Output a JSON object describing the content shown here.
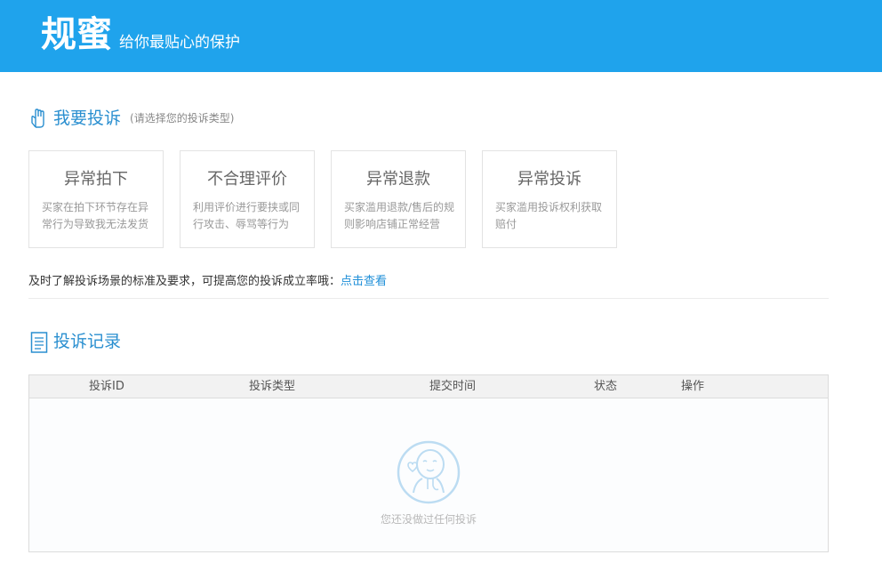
{
  "header": {
    "brand": "规蜜",
    "slogan": "给你最贴心的保护"
  },
  "complaint_section": {
    "icon": "hand-icon",
    "title": "我要投诉",
    "subtitle": "(请选择您的投诉类型)",
    "cards": [
      {
        "title": "异常拍下",
        "desc": "买家在拍下环节存在异常行为导致我无法发货"
      },
      {
        "title": "不合理评价",
        "desc": "利用评价进行要挟或同行攻击、辱骂等行为"
      },
      {
        "title": "异常退款",
        "desc": "买家滥用退款/售后的规则影响店铺正常经营"
      },
      {
        "title": "异常投诉",
        "desc": "买家滥用投诉权利获取赔付"
      }
    ],
    "tip_text": "及时了解投诉场景的标准及要求，可提高您的投诉成立率哦：",
    "tip_link": "点击查看"
  },
  "records_section": {
    "icon": "document-icon",
    "title": "投诉记录",
    "columns": [
      "投诉ID",
      "投诉类型",
      "提交时间",
      "状态",
      "操作"
    ],
    "empty_icon": "empty-face-icon",
    "empty_text": "您还没做过任何投诉"
  },
  "colors": {
    "header_bg": "#1fa3ec",
    "accent": "#2a8fd0",
    "link": "#1f8fd8"
  }
}
